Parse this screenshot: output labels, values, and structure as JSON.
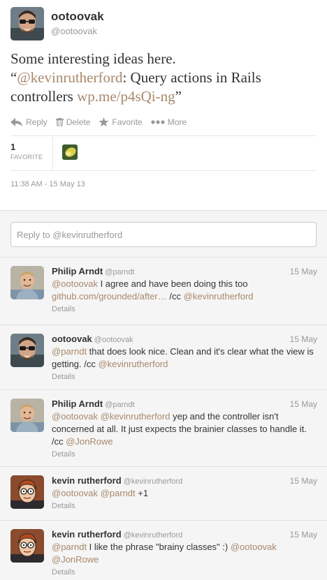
{
  "tweet": {
    "name": "ootoovak",
    "handle": "@ootoovak",
    "text_line1": "Some interesting ideas here.",
    "quote_open": "“",
    "mention": "@kevinrutherford",
    "text_mid": ": Query actions in Rails controllers ",
    "link": "wp.me/p4sQi-ng",
    "quote_close": "”",
    "actions": [
      {
        "label": "Reply",
        "icon": "reply-icon"
      },
      {
        "label": "Delete",
        "icon": "trash-icon"
      },
      {
        "label": "Favorite",
        "icon": "star-icon"
      },
      {
        "label": "More",
        "icon": "more-dots-icon"
      }
    ],
    "favorites_count": "1",
    "favorites_label": "FAVORITE",
    "timestamp": "11:38 AM - 15 May 13"
  },
  "reply_box": {
    "placeholder": "Reply to @kevinrutherford"
  },
  "details_label": "Details",
  "colors": {
    "link": "#a8896b",
    "muted": "#999999",
    "reply_bg": "#f5f5f5"
  },
  "replies": [
    {
      "name": "Philip Arndt",
      "handle": "@parndt",
      "date": "15 May",
      "avatar": "philip-avatar",
      "line1_mention": "@ootoovak",
      "line1_text": " I agree and have been doing this too",
      "line2_link": "github.com/grounded/after…",
      "line2_text": " /cc ",
      "line2_mention": "@kevinrutherford"
    },
    {
      "name": "ootoovak",
      "handle": "@ootoovak",
      "date": "15 May",
      "avatar": "ootoovak-avatar",
      "mention1": "@parndt",
      "text1": " that does look nice. Clean and it's clear what the view is getting. /cc ",
      "mention2": "@kevinrutherford"
    },
    {
      "name": "Philip Arndt",
      "handle": "@parndt",
      "date": "15 May",
      "avatar": "philip-avatar",
      "mention1": "@ootoovak",
      "mention2": "@kevinrutherford",
      "text1": " yep and the controller isn't concerned at all. It just expects the brainier classes to handle it. /cc ",
      "mention3": "@JonRowe"
    },
    {
      "name": "kevin rutherford",
      "handle": "@kevinrutherford",
      "date": "15 May",
      "avatar": "kevin-avatar",
      "mention1": "@ootoovak",
      "mention2": "@parndt",
      "text1": " +1"
    },
    {
      "name": "kevin rutherford",
      "handle": "@kevinrutherford",
      "date": "15 May",
      "avatar": "kevin-avatar",
      "mention1": "@parndt",
      "text1": " I like the phrase \"brainy classes\" :) ",
      "mention2": "@ootoovak",
      "mention3": "@JonRowe"
    }
  ]
}
